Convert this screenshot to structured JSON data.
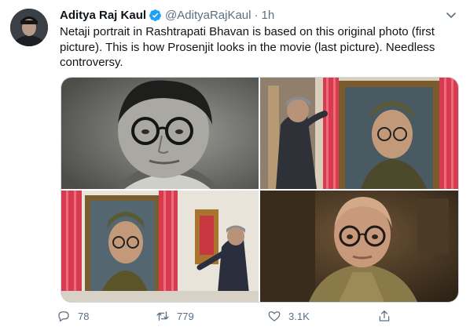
{
  "tweet": {
    "author_name": "Aditya Raj Kaul",
    "handle": "@AdityaRajKaul",
    "separator": "·",
    "time": "1h",
    "verified": true,
    "text": "Netaji portrait in Rashtrapati Bhavan is based on this original photo (first picture). This is how Prosenjit looks in the movie (last picture). Needless controversy."
  },
  "media": {
    "photos": [
      {
        "name": "black-and-white-portrait-photo"
      },
      {
        "name": "portrait-unveiling-photo"
      },
      {
        "name": "portrait-unveiling-second-angle-photo"
      },
      {
        "name": "movie-still-photo"
      }
    ]
  },
  "actions": {
    "reply_count": "78",
    "retweet_count": "779",
    "like_count": "3.1K"
  },
  "icons": {
    "verified": "verified-badge-icon",
    "more": "chevron-down-icon",
    "reply": "reply-icon",
    "retweet": "retweet-icon",
    "like": "heart-icon",
    "share": "share-icon"
  },
  "colors": {
    "text": "#0f1419",
    "secondary": "#5b7083",
    "verified": "#1da1f2",
    "border": "#cfd9de"
  }
}
